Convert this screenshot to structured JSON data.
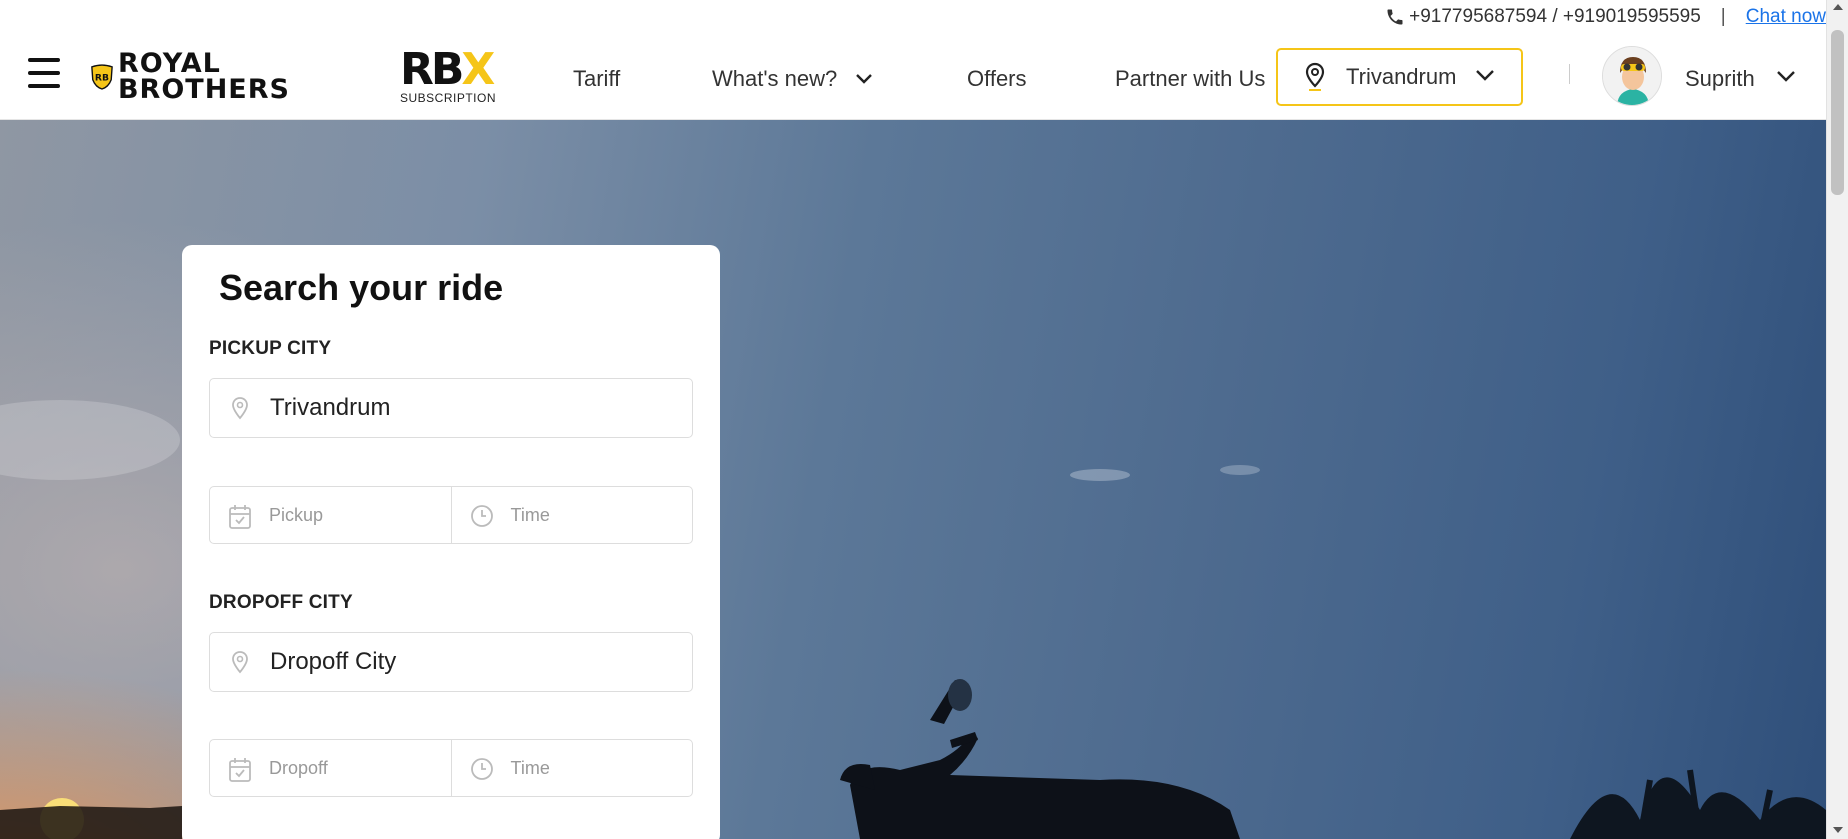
{
  "topbar": {
    "phone_icon": "phone-icon",
    "phones": "+917795687594 / +919019595595",
    "separator": "|",
    "chat_label": "Chat now"
  },
  "nav": {
    "menu_icon": "hamburger-icon",
    "brand_line1": "ROYAL",
    "brand_line2": "BROTHERS",
    "brand_badge": "RB",
    "rbx_mark": "RB",
    "rbx_x": "X",
    "rbx_sub": "SUBSCRIPTION",
    "links": {
      "tariff": "Tariff",
      "whats_new": "What's new?",
      "offers": "Offers",
      "partner": "Partner with Us"
    },
    "city": "Trivandrum",
    "user_name": "Suprith"
  },
  "search": {
    "title": "Search your ride",
    "pickup_label": "PICKUP CITY",
    "pickup_city": "Trivandrum",
    "pickup_date_placeholder": "Pickup",
    "pickup_time_placeholder": "Time",
    "dropoff_label": "DROPOFF CITY",
    "dropoff_city_placeholder": "Dropoff City",
    "dropoff_date_placeholder": "Dropoff",
    "dropoff_time_placeholder": "Time"
  },
  "colors": {
    "brand_yellow": "#f5c518",
    "link_blue": "#1a73e8"
  }
}
